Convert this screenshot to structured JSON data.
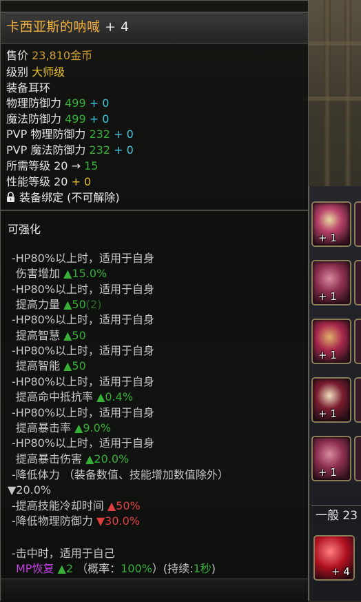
{
  "item": {
    "name": "卡西亚斯的呐喊",
    "enhance": "+ 4",
    "price_label": "售价",
    "price_value": "23,810",
    "price_unit": "金币",
    "grade_label": "级别",
    "grade_value": "大师级",
    "equip_label": "装备",
    "equip_value": "耳环",
    "phys_def_label": "物理防御力",
    "phys_def_value": "499",
    "phys_def_bonus": "+ 0",
    "mag_def_label": "魔法防御力",
    "mag_def_value": "499",
    "mag_def_bonus": "+ 0",
    "pvp_phys_label": "PVP 物理防御力",
    "pvp_phys_value": "232",
    "pvp_phys_bonus": "+ 0",
    "pvp_mag_label": "PVP 魔法防御力",
    "pvp_mag_value": "232",
    "pvp_mag_bonus": "+ 0",
    "req_level_label": "所需等级",
    "req_level_from": "20",
    "req_level_arrow": "→",
    "req_level_to": "15",
    "perf_level_label": "性能等级",
    "perf_level_value": "20",
    "perf_level_bonus": "+ 0",
    "bind_text": "装备绑定 (不可解除)"
  },
  "enhance_section": {
    "title": "可强化",
    "options": [
      {
        "cond": "-HP80%以上时，适用于自身",
        "effect": "伤害增加",
        "value": "▲15.0%",
        "suffix": ""
      },
      {
        "cond": "-HP80%以上时，适用于自身",
        "effect": "提高力量",
        "value": "▲50",
        "suffix": "(2)"
      },
      {
        "cond": "-HP80%以上时，适用于自身",
        "effect": "提高智慧",
        "value": "▲50",
        "suffix": ""
      },
      {
        "cond": "-HP80%以上时，适用于自身",
        "effect": "提高智能",
        "value": "▲50",
        "suffix": ""
      },
      {
        "cond": "-HP80%以上时，适用于自身",
        "effect": "提高命中抵抗率",
        "value": "▲0.4%",
        "suffix": ""
      },
      {
        "cond": "-HP80%以上时，适用于自身",
        "effect": "提高暴击率",
        "value": "▲9.0%",
        "suffix": ""
      },
      {
        "cond": "-HP80%以上时，适用于自身",
        "effect": "提高暴击伤害",
        "value": "▲20.0%",
        "suffix": ""
      }
    ],
    "neg1_text": "-降低体力 （装备数值、技能增加数值除外）",
    "neg1_value": "▼20.0%",
    "neg2_text": "-提高技能冷却时间",
    "neg2_value": "▲50%",
    "neg3_text": "-降低物理防御力",
    "neg3_value": "▼30.0%",
    "proc_cond": "-击中时，适用于自己",
    "proc_effect": "MP恢复",
    "proc_value": "▲2",
    "proc_chance_label": "（概率：",
    "proc_chance_value": "100%",
    "proc_chance_close": "）",
    "proc_duration_label": "(持续:",
    "proc_duration_value": "1秒",
    "proc_duration_close": ")"
  },
  "inventory": {
    "slot_counts": [
      "+ 1",
      "+ 1",
      "+ 1",
      "+ 1",
      "+ 1"
    ],
    "tab_label": "一般 23",
    "bottom_slot_count": "+ 4"
  },
  "colors": {
    "title": "#f0ae3c",
    "positive": "#38b038",
    "bonus": "#40c8e0",
    "negative": "#e04040",
    "proc": "#c040e0"
  }
}
